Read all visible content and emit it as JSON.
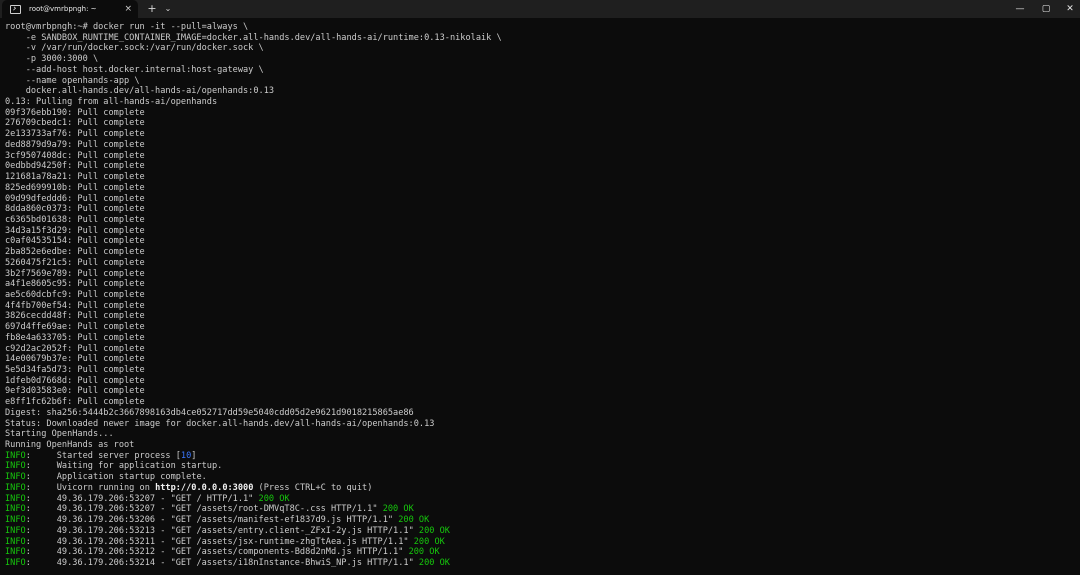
{
  "window": {
    "tab_title": "root@vmrbpngh: ~",
    "new_tab_label": "+",
    "dropdown_label": "⌄",
    "tab_close_label": "×",
    "minimize_label": "—",
    "maximize_label": "▢",
    "close_label": "✕"
  },
  "terminal": {
    "lines": [
      [
        {
          "t": "root@vmrbpngh:~# docker run -it --pull=always \\",
          "c": "white"
        }
      ],
      [
        {
          "t": "    -e SANDBOX_RUNTIME_CONTAINER_IMAGE=docker.all-hands.dev/all-hands-ai/runtime:0.13-nikolaik \\",
          "c": "white"
        }
      ],
      [
        {
          "t": "    -v /var/run/docker.sock:/var/run/docker.sock \\",
          "c": "white"
        }
      ],
      [
        {
          "t": "    -p 3000:3000 \\",
          "c": "white"
        }
      ],
      [
        {
          "t": "    --add-host host.docker.internal:host-gateway \\",
          "c": "white"
        }
      ],
      [
        {
          "t": "    --name openhands-app \\",
          "c": "white"
        }
      ],
      [
        {
          "t": "    docker.all-hands.dev/all-hands-ai/openhands:0.13",
          "c": "white"
        }
      ],
      [
        {
          "t": "0.13: Pulling from all-hands-ai/openhands",
          "c": "white"
        }
      ],
      [
        {
          "t": "09f376ebb190: Pull complete",
          "c": "white"
        }
      ],
      [
        {
          "t": "276709cbedc1: Pull complete",
          "c": "white"
        }
      ],
      [
        {
          "t": "2e133733af76: Pull complete",
          "c": "white"
        }
      ],
      [
        {
          "t": "ded8879d9a79: Pull complete",
          "c": "white"
        }
      ],
      [
        {
          "t": "3cf9507408dc: Pull complete",
          "c": "white"
        }
      ],
      [
        {
          "t": "0edbbd94250f: Pull complete",
          "c": "white"
        }
      ],
      [
        {
          "t": "121681a78a21: Pull complete",
          "c": "white"
        }
      ],
      [
        {
          "t": "825ed699910b: Pull complete",
          "c": "white"
        }
      ],
      [
        {
          "t": "09d99dfeddd6: Pull complete",
          "c": "white"
        }
      ],
      [
        {
          "t": "8dda860c0373: Pull complete",
          "c": "white"
        }
      ],
      [
        {
          "t": "c6365bd01638: Pull complete",
          "c": "white"
        }
      ],
      [
        {
          "t": "34d3a15f3d29: Pull complete",
          "c": "white"
        }
      ],
      [
        {
          "t": "c0af04535154: Pull complete",
          "c": "white"
        }
      ],
      [
        {
          "t": "2ba852e6edbe: Pull complete",
          "c": "white"
        }
      ],
      [
        {
          "t": "5260475f21c5: Pull complete",
          "c": "white"
        }
      ],
      [
        {
          "t": "3b2f7569e789: Pull complete",
          "c": "white"
        }
      ],
      [
        {
          "t": "a4f1e8605c95: Pull complete",
          "c": "white"
        }
      ],
      [
        {
          "t": "ae5c60dcbfc9: Pull complete",
          "c": "white"
        }
      ],
      [
        {
          "t": "4f4fb700ef54: Pull complete",
          "c": "white"
        }
      ],
      [
        {
          "t": "3826cecdd48f: Pull complete",
          "c": "white"
        }
      ],
      [
        {
          "t": "697d4ffe69ae: Pull complete",
          "c": "white"
        }
      ],
      [
        {
          "t": "fb8e4a633705: Pull complete",
          "c": "white"
        }
      ],
      [
        {
          "t": "c92d2ac2052f: Pull complete",
          "c": "white"
        }
      ],
      [
        {
          "t": "14e00679b37e: Pull complete",
          "c": "white"
        }
      ],
      [
        {
          "t": "5e5d34fa5d73: Pull complete",
          "c": "white"
        }
      ],
      [
        {
          "t": "1dfeb0d7668d: Pull complete",
          "c": "white"
        }
      ],
      [
        {
          "t": "9ef3d03583e0: Pull complete",
          "c": "white"
        }
      ],
      [
        {
          "t": "e8ff1fc62b6f: Pull complete",
          "c": "white"
        }
      ],
      [
        {
          "t": "Digest: sha256:5444b2c3667898163db4ce052717dd59e5040cdd05d2e9621d9018215865ae86",
          "c": "white"
        }
      ],
      [
        {
          "t": "Status: Downloaded newer image for docker.all-hands.dev/all-hands-ai/openhands:0.13",
          "c": "white"
        }
      ],
      [
        {
          "t": "Starting OpenHands...",
          "c": "white"
        }
      ],
      [
        {
          "t": "Running OpenHands as root",
          "c": "white"
        }
      ],
      [
        {
          "t": "INFO",
          "c": "green"
        },
        {
          "t": ":     Started server process [",
          "c": "white"
        },
        {
          "t": "10",
          "c": "blue"
        },
        {
          "t": "]",
          "c": "white"
        }
      ],
      [
        {
          "t": "INFO",
          "c": "green"
        },
        {
          "t": ":     Waiting for application startup.",
          "c": "white"
        }
      ],
      [
        {
          "t": "INFO",
          "c": "green"
        },
        {
          "t": ":     Application startup complete.",
          "c": "white"
        }
      ],
      [
        {
          "t": "INFO",
          "c": "green"
        },
        {
          "t": ":     Uvicorn running on ",
          "c": "white"
        },
        {
          "t": "http://0.0.0.0:3000",
          "c": "bright"
        },
        {
          "t": " (Press CTRL+C to quit)",
          "c": "white"
        }
      ],
      [
        {
          "t": "INFO",
          "c": "green"
        },
        {
          "t": ":     49.36.179.206:53207 - \"GET / HTTP/1.1\" ",
          "c": "white"
        },
        {
          "t": "200 OK",
          "c": "green"
        }
      ],
      [
        {
          "t": "INFO",
          "c": "green"
        },
        {
          "t": ":     49.36.179.206:53207 - \"GET /assets/root-DMVqT8C-.css HTTP/1.1\" ",
          "c": "white"
        },
        {
          "t": "200 OK",
          "c": "green"
        }
      ],
      [
        {
          "t": "INFO",
          "c": "green"
        },
        {
          "t": ":     49.36.179.206:53206 - \"GET /assets/manifest-ef1837d9.js HTTP/1.1\" ",
          "c": "white"
        },
        {
          "t": "200 OK",
          "c": "green"
        }
      ],
      [
        {
          "t": "INFO",
          "c": "green"
        },
        {
          "t": ":     49.36.179.206:53213 - \"GET /assets/entry.client-_ZFxI-2y.js HTTP/1.1\" ",
          "c": "white"
        },
        {
          "t": "200 OK",
          "c": "green"
        }
      ],
      [
        {
          "t": "INFO",
          "c": "green"
        },
        {
          "t": ":     49.36.179.206:53211 - \"GET /assets/jsx-runtime-zhgTtAea.js HTTP/1.1\" ",
          "c": "white"
        },
        {
          "t": "200 OK",
          "c": "green"
        }
      ],
      [
        {
          "t": "INFO",
          "c": "green"
        },
        {
          "t": ":     49.36.179.206:53212 - \"GET /assets/components-Bd8d2nMd.js HTTP/1.1\" ",
          "c": "white"
        },
        {
          "t": "200 OK",
          "c": "green"
        }
      ],
      [
        {
          "t": "INFO",
          "c": "green"
        },
        {
          "t": ":     49.36.179.206:53214 - \"GET /assets/i18nInstance-BhwiS_NP.js HTTP/1.1\" ",
          "c": "white"
        },
        {
          "t": "200 OK",
          "c": "green"
        }
      ]
    ]
  }
}
